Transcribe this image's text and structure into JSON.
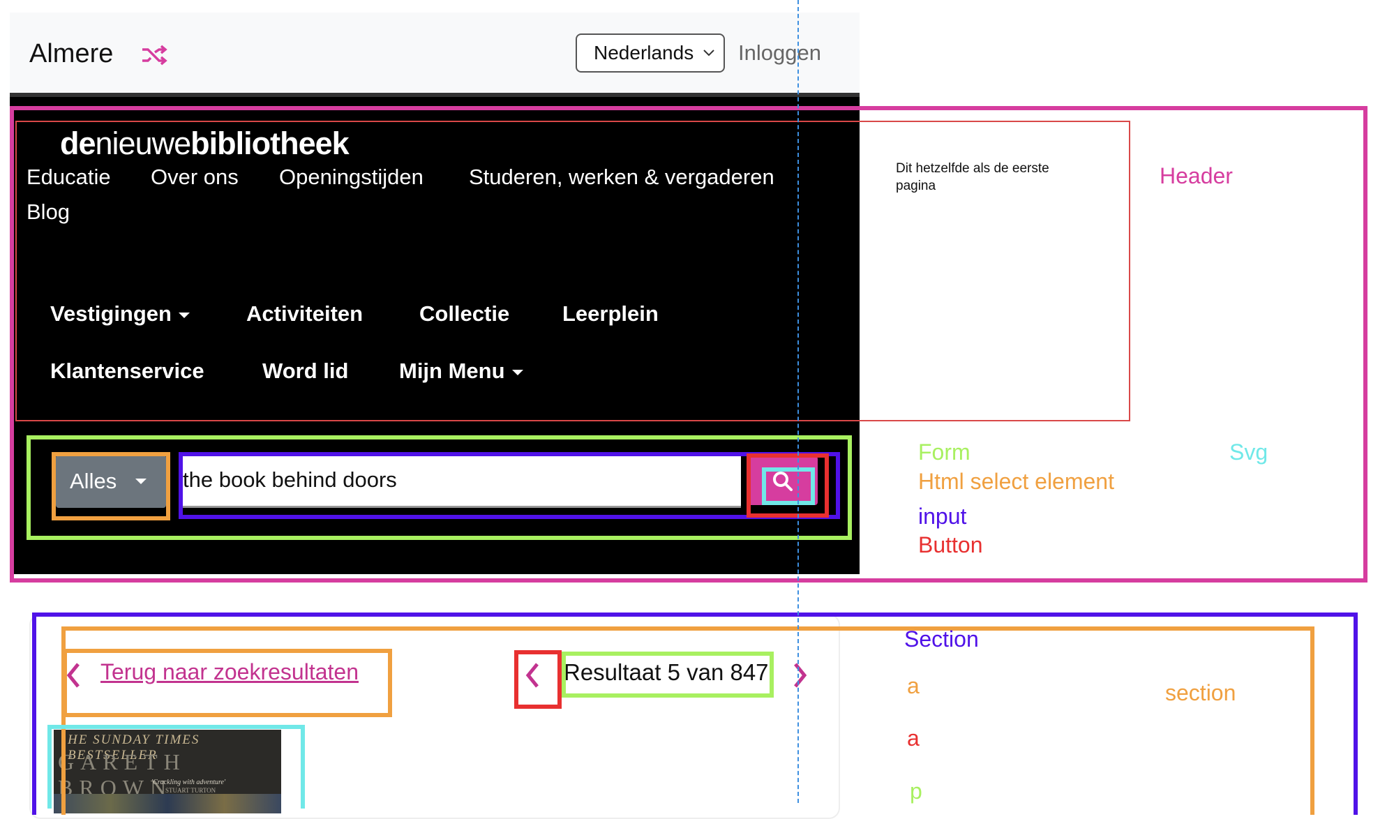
{
  "topbar": {
    "city": "Almere",
    "language": "Nederlands",
    "login": "Inloggen"
  },
  "header": {
    "logo_light_1": "de",
    "logo_light_2": "nieuwe",
    "logo_bold": "bibliotheek",
    "utility_nav": [
      "Educatie",
      "Over ons",
      "Openingstijden",
      "Studeren, werken & vergaderen",
      "Blog"
    ],
    "main_nav": {
      "vestigingen": "Vestigingen",
      "activiteiten": "Activiteiten",
      "collectie": "Collectie",
      "leerplein": "Leerplein",
      "klantenservice": "Klantenservice",
      "word_lid": "Word lid",
      "mijn_menu": "Mijn Menu"
    },
    "search": {
      "scope": "Alles",
      "query": "the book behind doors"
    }
  },
  "annotations": {
    "note": "Dit hetzelfde als de eerste pagina",
    "header": "Header",
    "form": "Form",
    "svg": "Svg",
    "select": "Html select element",
    "input": "input",
    "button": "Button",
    "section_upper": "Section",
    "section_lower": "section",
    "a1": "a",
    "a2": "a",
    "p": "p"
  },
  "colors": {
    "pink": "#d63d9f",
    "orange": "#f0a040",
    "green": "#a8f060",
    "purple": "#5012e8",
    "red": "#e83030",
    "cyan": "#70e8e8"
  },
  "result_nav": {
    "back": "Terug naar zoekresultaten",
    "count": "Resultaat 5 van 847"
  },
  "book": {
    "tagline": "HE SUNDAY TIMES BESTSELLER",
    "author": "GARETH BROWN",
    "quote": "'Crackling with adventure'",
    "quote_author": "STUART TURTON"
  }
}
